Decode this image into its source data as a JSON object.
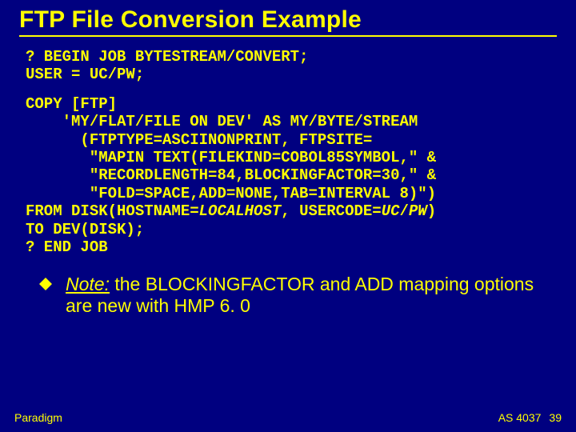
{
  "title": "FTP File Conversion Example",
  "code_block1": [
    "? BEGIN JOB BYTESTREAM/CONVERT;",
    "USER = UC/PW;"
  ],
  "code_block2": [
    "COPY [FTP]",
    "    'MY/FLAT/FILE ON DEV' AS MY/BYTE/STREAM",
    "      (FTPTYPE=ASCIINONPRINT, FTPSITE=",
    "       \"MAPIN TEXT(FILEKIND=COBOL85SYMBOL,\" &",
    "       \"RECORDLENGTH=84,BLOCKINGFACTOR=30,\" &",
    "       \"FOLD=SPACE,ADD=NONE,TAB=INTERVAL 8)\")"
  ],
  "code_from_line": {
    "prefix": "FROM DISK(HOSTNAME=",
    "host": "LOCALHOST",
    "mid": ", USERCODE=",
    "uc": "UC",
    "slash": "/",
    "pw": "PW",
    "suffix": ")"
  },
  "code_block3": [
    "TO DEV(DISK);",
    "? END JOB"
  ],
  "note": {
    "label": "Note:",
    "text": " the BLOCKINGFACTOR and ADD mapping options are new with HMP 6. 0"
  },
  "footer": {
    "left": "Paradigm",
    "right_code": "AS 4037",
    "page": "39"
  }
}
